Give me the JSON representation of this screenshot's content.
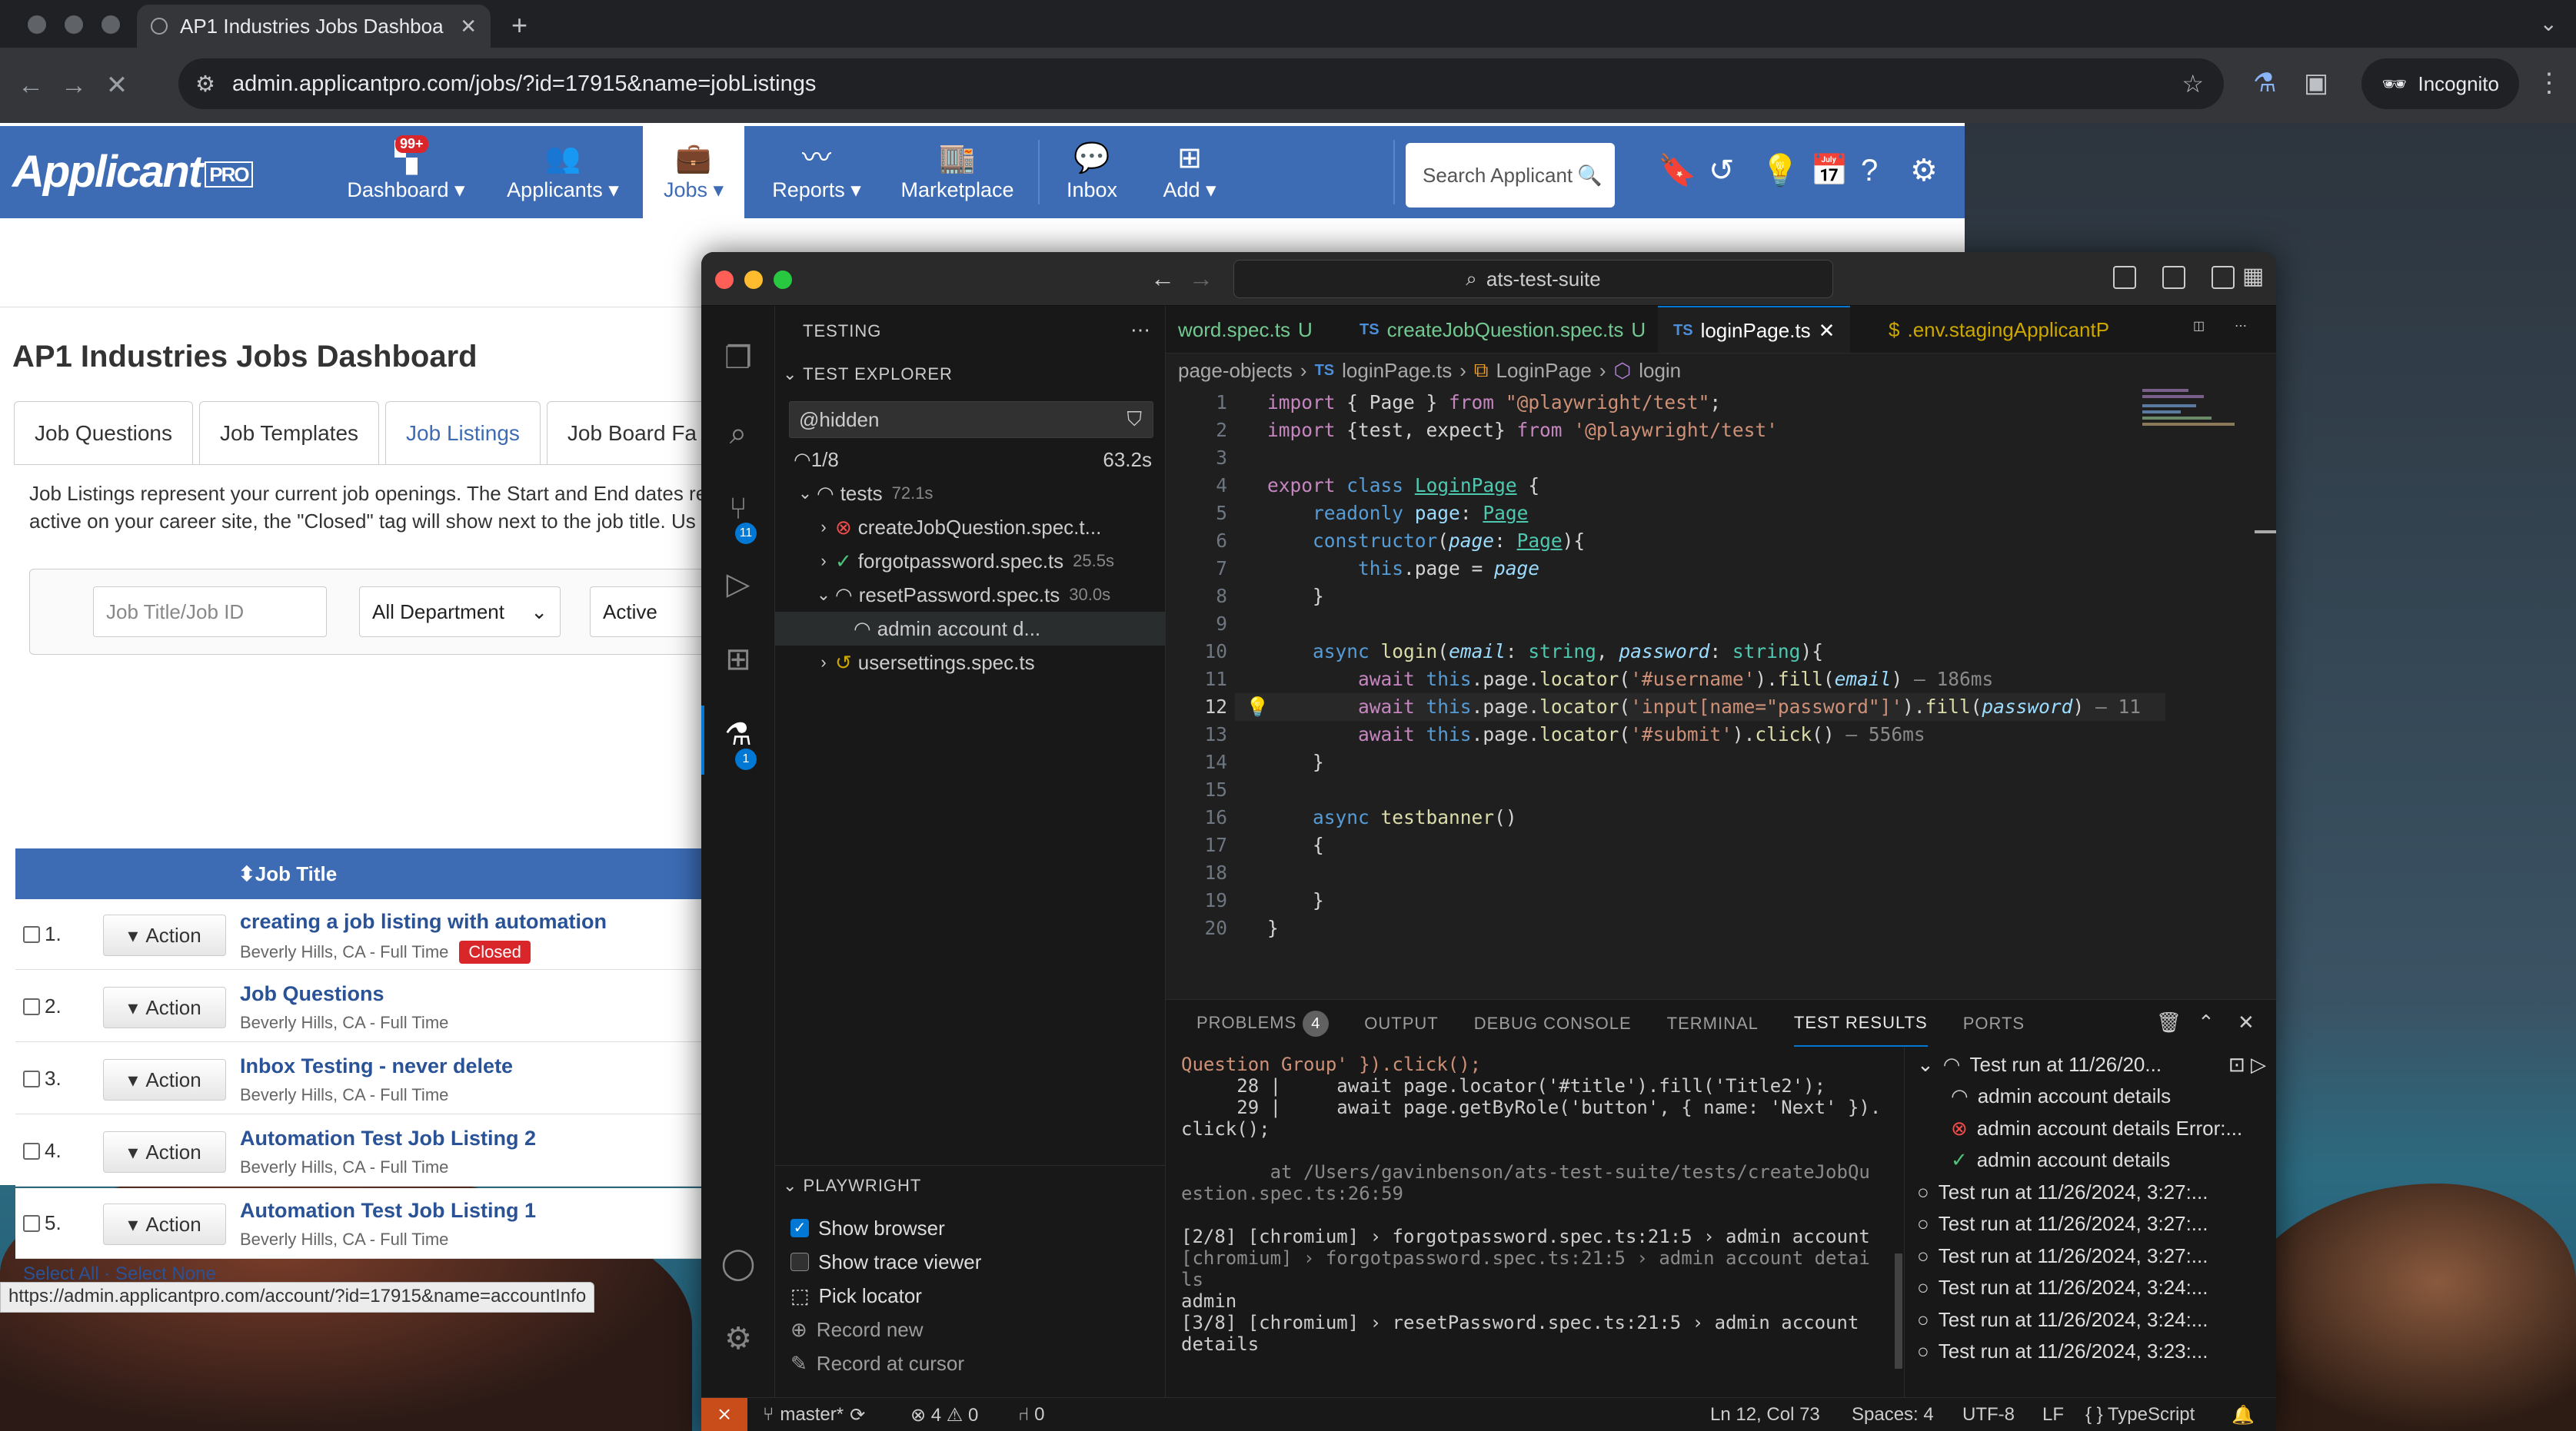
{
  "browser": {
    "tab_title": "AP1 Industries Jobs Dashboa",
    "url": "admin.applicantpro.com/jobs/?id=17915&name=jobListings",
    "incognito_label": "Incognito",
    "status_url": "https://admin.applicantpro.com/account/?id=17915&name=accountInfo"
  },
  "site": {
    "logo": "Applicant",
    "logo_pro": "PRO",
    "nav": [
      {
        "label": "Dashboard ▾",
        "icon": "dashboard-icon",
        "badge": "99+"
      },
      {
        "label": "Applicants ▾",
        "icon": "users-icon"
      },
      {
        "label": "Jobs ▾",
        "icon": "briefcase-icon",
        "active": true
      },
      {
        "label": "Reports ▾",
        "icon": "chart-icon"
      },
      {
        "label": "Marketplace",
        "icon": "store-icon"
      },
      {
        "label": "Inbox",
        "icon": "inbox-icon"
      },
      {
        "label": "Add ▾",
        "icon": "add-icon"
      }
    ],
    "search_placeholder": "Search Applicant",
    "page_title": "AP1 Industries Jobs Dashboard",
    "tabs": [
      "Job Questions",
      "Job Templates",
      "Job Listings",
      "Job Board Fa"
    ],
    "description_line1": "Job Listings represent your current job openings. The Start and End dates re",
    "description_line2": "active on your career site, the \"Closed\" tag will show next to the job title. Us",
    "filter_title_placeholder": "Job Title/Job ID",
    "filter_department": "All Department",
    "filter_status": "Active",
    "table_header": "⬍Job Title",
    "action_label": "Action",
    "closed_tag": "Closed",
    "rows": [
      {
        "num": "1.",
        "title": "creating a job listing with automation",
        "location": "Beverly Hills, CA - Full Time",
        "closed": true
      },
      {
        "num": "2.",
        "title": "Job Questions",
        "location": "Beverly Hills, CA - Full Time"
      },
      {
        "num": "3.",
        "title": "Inbox Testing - never delete",
        "location": "Beverly Hills, CA - Full Time"
      },
      {
        "num": "4.",
        "title": "Automation Test Job Listing 2",
        "location": "Beverly Hills, CA - Full Time"
      },
      {
        "num": "5.",
        "title": "Automation Test Job Listing 1",
        "location": "Beverly Hills, CA - Full Time"
      }
    ],
    "select_all": "Select All · Select None"
  },
  "vscode": {
    "command_center": "ats-test-suite",
    "sidebar_title": "TESTING",
    "explorer_title": "TEST EXPLORER",
    "filter_value": "@hidden",
    "progress": "1/8",
    "progress_time": "63.2s",
    "tree": [
      {
        "label": "tests",
        "dur": "72.1s",
        "state": "spin",
        "indent": 0,
        "chev": "⌄"
      },
      {
        "label": "createJobQuestion.spec.t...",
        "dur": "",
        "state": "fail",
        "indent": 1,
        "chev": "›"
      },
      {
        "label": "forgotpassword.spec.ts",
        "dur": "25.5s",
        "state": "pass",
        "indent": 1,
        "chev": "›"
      },
      {
        "label": "resetPassword.spec.ts",
        "dur": "30.0s",
        "state": "spin",
        "indent": 1,
        "chev": "⌄"
      },
      {
        "label": "admin account d...",
        "dur": "",
        "state": "spin",
        "indent": 2,
        "chev": ""
      },
      {
        "label": "usersettings.spec.ts",
        "dur": "",
        "state": "skip",
        "indent": 1,
        "chev": "›"
      }
    ],
    "playwright_title": "PLAYWRIGHT",
    "playwright_items": [
      {
        "label": "Show browser",
        "type": "checkbox",
        "checked": true
      },
      {
        "label": "Show trace viewer",
        "type": "checkbox",
        "checked": false
      },
      {
        "label": "Pick locator",
        "type": "action"
      },
      {
        "label": "Record new",
        "type": "action"
      },
      {
        "label": "Record at cursor",
        "type": "action"
      }
    ],
    "editor_tabs": [
      {
        "label": "word.spec.ts",
        "suffix": "U"
      },
      {
        "label": "createJobQuestion.spec.ts",
        "suffix": "U"
      },
      {
        "label": "loginPage.ts",
        "suffix": "✕",
        "active": true
      },
      {
        "label": ".env.stagingApplicantP",
        "suffix": ""
      }
    ],
    "breadcrumb": [
      "page-objects",
      "loginPage.ts",
      "LoginPage",
      "login"
    ],
    "cursor_line": "12",
    "panel_tabs": [
      "PROBLEMS",
      "OUTPUT",
      "DEBUG CONSOLE",
      "TERMINAL",
      "TEST RESULTS",
      "PORTS"
    ],
    "problems_count": "4",
    "terminal_lines": [
      "Question Group' }).click();",
      "     28 |     await page.locator('#title').fill('Title2');",
      "     29 |     await page.getByRole('button', { name: 'Next' }).",
      "click();",
      "",
      "        at /Users/gavinbenson/ats-test-suite/tests/createJobQu",
      "estion.spec.ts:26:59",
      "",
      "[2/8] [chromium] › forgotpassword.spec.ts:21:5 › admin account",
      "[chromium] › forgotpassword.spec.ts:21:5 › admin account detai",
      "ls",
      "admin",
      "[3/8] [chromium] › resetPassword.spec.ts:21:5 › admin account",
      "details"
    ],
    "results": [
      {
        "label": "Test run at 11/26/20...",
        "state": "spin",
        "indent": 0,
        "chev": "⌄"
      },
      {
        "label": "admin account details",
        "state": "spin",
        "indent": 1
      },
      {
        "label": "admin account details Error:...",
        "state": "fail",
        "indent": 1
      },
      {
        "label": "admin account details",
        "state": "pass",
        "indent": 1
      },
      {
        "label": "Test run at 11/26/2024, 3:27:...",
        "state": "idle",
        "indent": 0
      },
      {
        "label": "Test run at 11/26/2024, 3:27:...",
        "state": "idle",
        "indent": 0
      },
      {
        "label": "Test run at 11/26/2024, 3:27:...",
        "state": "idle",
        "indent": 0
      },
      {
        "label": "Test run at 11/26/2024, 3:24:...",
        "state": "idle",
        "indent": 0
      },
      {
        "label": "Test run at 11/26/2024, 3:24:...",
        "state": "idle",
        "indent": 0
      },
      {
        "label": "Test run at 11/26/2024, 3:23:...",
        "state": "idle",
        "indent": 0
      }
    ],
    "status": {
      "branch": "master*",
      "errors": "⊗ 4 ⚠ 0",
      "ports": "⑁ 0",
      "position": "Ln 12, Col 73",
      "spaces": "Spaces: 4",
      "encoding": "UTF-8",
      "eol": "LF",
      "language": "{ } TypeScript"
    }
  }
}
